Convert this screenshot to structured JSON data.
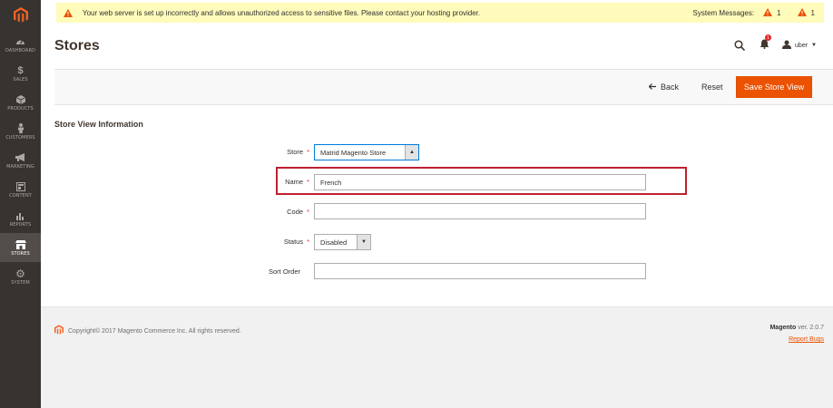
{
  "sidebar": {
    "items": [
      {
        "label": "DASHBOARD",
        "icon": "dashboard-icon"
      },
      {
        "label": "SALES",
        "icon": "dollar-icon"
      },
      {
        "label": "PRODUCTS",
        "icon": "cube-icon"
      },
      {
        "label": "CUSTOMERS",
        "icon": "person-icon"
      },
      {
        "label": "MARKETING",
        "icon": "megaphone-icon"
      },
      {
        "label": "CONTENT",
        "icon": "layout-icon"
      },
      {
        "label": "REPORTS",
        "icon": "bar-chart-icon"
      },
      {
        "label": "STORES",
        "icon": "storefront-icon"
      },
      {
        "label": "SYSTEM",
        "icon": "gear-icon"
      }
    ]
  },
  "system_message": {
    "text": "Your web server is set up incorrectly and allows unauthorized access to sensitive files. Please contact your hosting provider.",
    "label": "System Messages:",
    "count_a": "1",
    "count_b": "1"
  },
  "header": {
    "title": "Stores",
    "notifications_count": "1",
    "user": "uber"
  },
  "toolbar": {
    "back": "Back",
    "reset": "Reset",
    "save": "Save Store View"
  },
  "section": {
    "title": "Store View Information"
  },
  "form": {
    "store_label": "Store",
    "store_value": "Matrid Magento Store",
    "name_label": "Name",
    "name_value": "French",
    "code_label": "Code",
    "code_value": "",
    "status_label": "Status",
    "status_value": "Disabled",
    "sort_label": "Sort Order",
    "sort_value": "",
    "required_mark": "*"
  },
  "footer": {
    "copyright": "Copyright© 2017 Magento Commerce Inc. All rights reserved.",
    "brand": "Magento",
    "version": " ver. 2.0.7",
    "report": "Report Bugs"
  },
  "colors": {
    "accent": "#eb5202",
    "sidebar": "#373330",
    "highlight": "#c02030",
    "warning": "#fffbbb"
  }
}
